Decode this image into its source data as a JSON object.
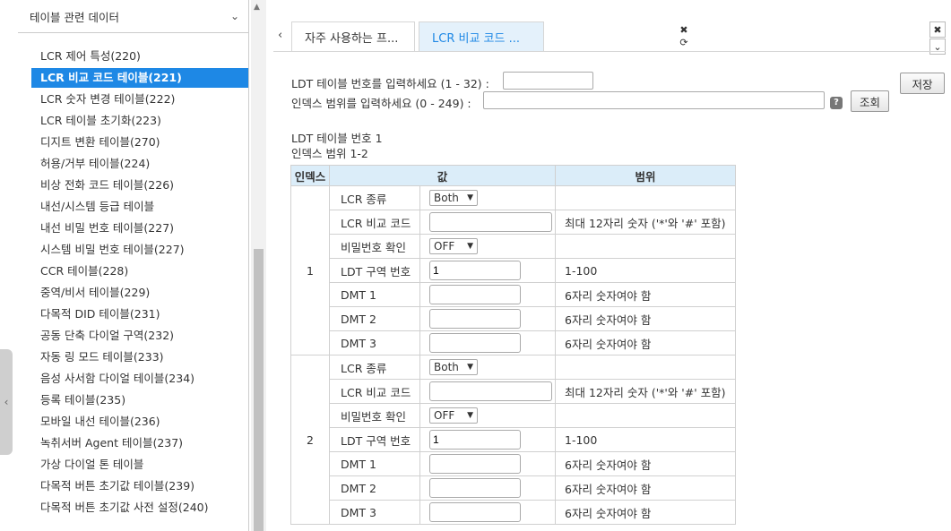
{
  "sidebar": {
    "header_title": "테이블 관련 데이터",
    "items": [
      {
        "label": "LCR 제어 특성(220)"
      },
      {
        "label": "LCR 비교 코드 테이블(221)",
        "active": true
      },
      {
        "label": "LCR 숫자 변경 테이블(222)"
      },
      {
        "label": "LCR 테이블 초기화(223)"
      },
      {
        "label": "디지트 변환 테이블(270)"
      },
      {
        "label": "허용/거부 테이블(224)"
      },
      {
        "label": "비상 전화 코드 테이블(226)"
      },
      {
        "label": "내선/시스템 등급 테이블"
      },
      {
        "label": "내선 비밀 번호 테이블(227)"
      },
      {
        "label": "시스템 비밀 번호 테이블(227)"
      },
      {
        "label": "CCR 테이블(228)"
      },
      {
        "label": "중역/비서 테이블(229)"
      },
      {
        "label": "다목적 DID 테이블(231)"
      },
      {
        "label": "공동 단축 다이얼 구역(232)"
      },
      {
        "label": "자동 링 모드 테이블(233)"
      },
      {
        "label": "음성 사서함 다이얼 테이블(234)"
      },
      {
        "label": "등록 테이블(235)"
      },
      {
        "label": "모바일 내선 테이블(236)"
      },
      {
        "label": "녹취서버 Agent 테이블(237)"
      },
      {
        "label": "가상 다이얼 톤 테이블"
      },
      {
        "label": "다목적 버튼 초기값 테이블(239)"
      },
      {
        "label": "다목적 버튼 초기값 사전 설정(240)"
      }
    ]
  },
  "tabs": [
    {
      "label": "자주 사용하는 프..."
    },
    {
      "label": "LCR 비교 코드 ..."
    }
  ],
  "form": {
    "table_prompt": "LDT 테이블 번호를 입력하세요 (1 - 32) :",
    "table_value": "",
    "index_prompt": "인덱스 범위를 입력하세요 (0 - 249) :",
    "index_value": "",
    "help_label": "?",
    "query_label": "조회",
    "save_label": "저장"
  },
  "info": {
    "table_line": "LDT 테이블 번호 1",
    "range_line": "인덱스 범위 1-2"
  },
  "grid": {
    "headers": {
      "index": "인덱스",
      "value": "값",
      "range": "범위"
    },
    "groups": [
      {
        "index": "1",
        "rows": [
          {
            "name": "LCR 종류",
            "kind": "select",
            "value": "Both",
            "range": ""
          },
          {
            "name": "LCR 비교 코드",
            "kind": "text",
            "value": "",
            "range": "최대 12자리 숫자 ('*'와 '#' 포함)"
          },
          {
            "name": "비밀번호 확인",
            "kind": "select",
            "value": "OFF",
            "range": ""
          },
          {
            "name": "LDT 구역 번호",
            "kind": "short",
            "value": "1",
            "range": "1-100"
          },
          {
            "name": "DMT 1",
            "kind": "short",
            "value": "",
            "range": "6자리 숫자여야 함"
          },
          {
            "name": "DMT 2",
            "kind": "short",
            "value": "",
            "range": "6자리 숫자여야 함"
          },
          {
            "name": "DMT 3",
            "kind": "short",
            "value": "",
            "range": "6자리 숫자여야 함"
          }
        ]
      },
      {
        "index": "2",
        "rows": [
          {
            "name": "LCR 종류",
            "kind": "select",
            "value": "Both",
            "range": ""
          },
          {
            "name": "LCR 비교 코드",
            "kind": "text",
            "value": "",
            "range": "최대 12자리 숫자 ('*'와 '#' 포함)"
          },
          {
            "name": "비밀번호 확인",
            "kind": "select",
            "value": "OFF",
            "range": ""
          },
          {
            "name": "LDT 구역 번호",
            "kind": "short",
            "value": "1",
            "range": "1-100"
          },
          {
            "name": "DMT 1",
            "kind": "short",
            "value": "",
            "range": "6자리 숫자여야 함"
          },
          {
            "name": "DMT 2",
            "kind": "short",
            "value": "",
            "range": "6자리 숫자여야 함"
          },
          {
            "name": "DMT 3",
            "kind": "short",
            "value": "",
            "range": "6자리 숫자여야 함"
          }
        ]
      }
    ]
  },
  "icons": {
    "collapse": "chevron-left-icon",
    "dropdown": "chevron-down-icon",
    "tab_prev": "chevron-left-icon",
    "tab_close": "close-icon",
    "tab_refresh": "refresh-icon",
    "window_close": "close-icon",
    "window_menu": "chevron-down-icon"
  },
  "colors": {
    "accent": "#1e88e5",
    "tab_active_bg": "#e4f1fb",
    "table_header_bg": "#dbedf9"
  }
}
